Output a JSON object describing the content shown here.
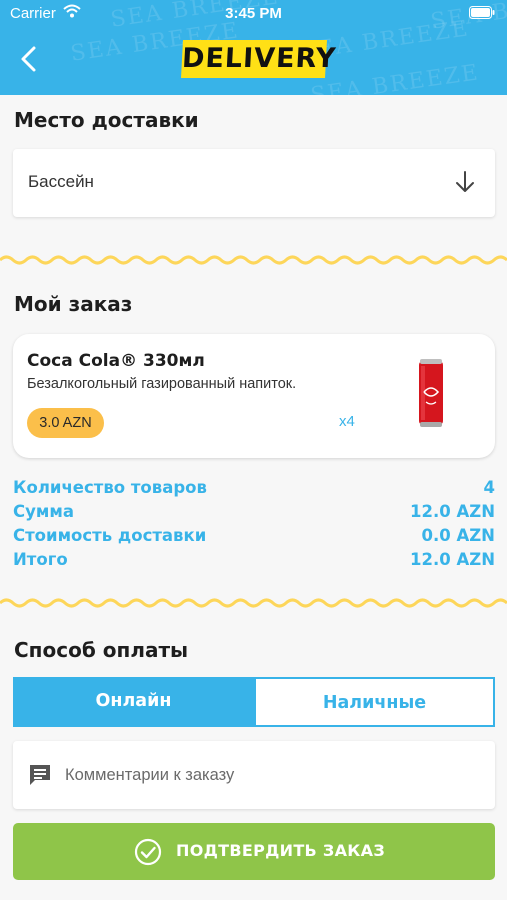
{
  "status_bar": {
    "carrier": "Carrier",
    "time": "3:45 PM"
  },
  "header": {
    "logo": "DELIVERY",
    "watermark": "SEA BREEZE",
    "back_icon": "chevron-left-icon"
  },
  "delivery_place": {
    "title": "Место доставки",
    "selected": "Бассейн",
    "icon": "arrow-down-icon"
  },
  "order": {
    "title": "Мой заказ",
    "item": {
      "name": "Coca Cola® 330мл",
      "description": "Безалкогольный газированный напиток.",
      "price": "3.0 AZN",
      "quantity": "x4",
      "image": "coca-cola-can-icon"
    },
    "summary": [
      {
        "label": "Количество товаров",
        "value": "4"
      },
      {
        "label": "Сумма",
        "value": "12.0 AZN"
      },
      {
        "label": "Стоимость доставки",
        "value": "0.0 AZN"
      },
      {
        "label": "Итого",
        "value": "12.0 AZN"
      }
    ]
  },
  "payment": {
    "title": "Способ оплаты",
    "options": [
      "Онлайн",
      "Наличные"
    ],
    "selected": "Онлайн"
  },
  "comment": {
    "placeholder": "Комментарии к заказу",
    "value": ""
  },
  "confirm": {
    "label": "ПОДТВЕРДИТЬ ЗАКАЗ"
  },
  "colors": {
    "primary": "#38b3e8",
    "accent": "#ffe016",
    "badge": "#fbbf4a",
    "confirm": "#8fc549",
    "wave": "#fdd65a"
  }
}
